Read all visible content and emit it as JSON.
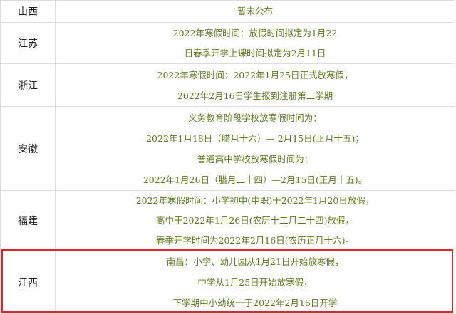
{
  "rows": [
    {
      "province": "山西",
      "lines": [
        "暂未公布"
      ]
    },
    {
      "province": "江苏",
      "lines": [
        "2022年寒假时间：放假时间拟定为1月22",
        "日春季开学上课时间拟定为2月11日"
      ]
    },
    {
      "province": "浙江",
      "lines": [
        "2022年寒假时间：2022年1月25日正式放寒假，",
        "2022年2月16日学生报到注册第二学期"
      ]
    },
    {
      "province": "安徽",
      "lines": [
        "义务教育阶段学校放寒假时间为：",
        "2022年1月18日（腊月十六）— 2月15日(正月十五)；",
        "普通高中学校放寒假时间为：",
        "2022年1月26日（腊月二十四）—2月15日(正月十五)。"
      ]
    },
    {
      "province": "福建",
      "lines": [
        "2022年寒假时间：小学初中(中职)于2022年1月20日放假，",
        "高中于2022年1月26日(农历十二月二十四)放假，",
        "春季开学时间为2022年2月16日(农历正月十六)。"
      ]
    },
    {
      "province": "江西",
      "lines": [
        "南昌：小学、幼儿园从1月21日开始放寒假，",
        "中学从1月25日开始放寒假，",
        "下学期中小幼统一于2022年2月16日开学"
      ]
    }
  ],
  "colors": {
    "row_text": "#5d7a1d",
    "province_text": "#222222",
    "grid": "#dcdcdc",
    "highlight": "#e0252d"
  }
}
